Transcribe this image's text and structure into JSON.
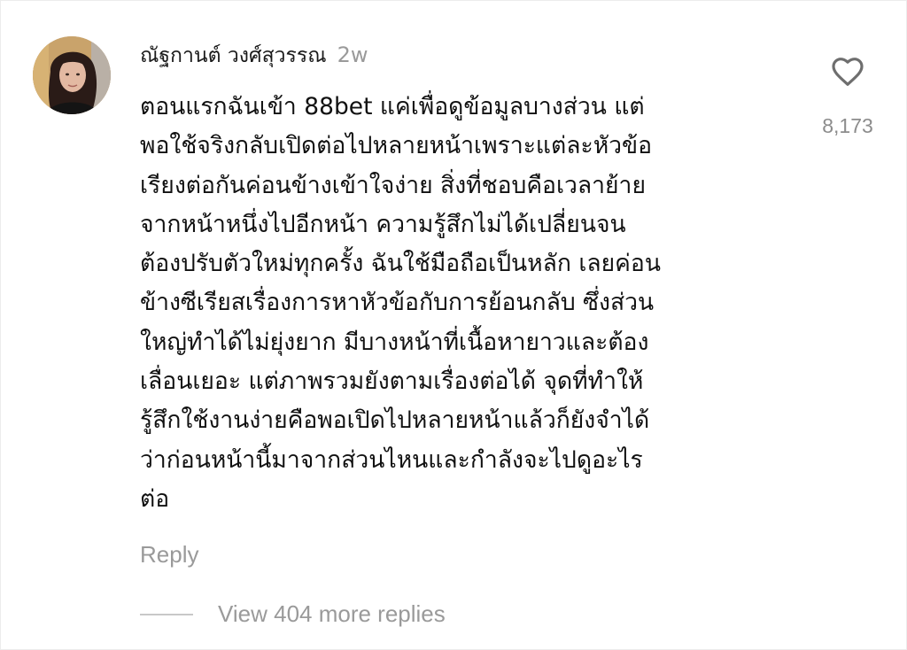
{
  "comment": {
    "author": "ณัฐกานต์ วงศ์สุวรรณ",
    "time": "2w",
    "lines": [
      "ตอนแรกฉันเข้า 88bet แค่เพื่อดูข้อมูลบางส่วน แต่",
      "พอใช้จริงกลับเปิดต่อไปหลายหน้าเพราะแต่ละหัวข้อ",
      "เรียงต่อกันค่อนข้างเข้าใจง่าย สิ่งที่ชอบคือเวลาย้าย",
      "จากหน้าหนึ่งไปอีกหน้า ความรู้สึกไม่ได้เปลี่ยนจน",
      "ต้องปรับตัวใหม่ทุกครั้ง ฉันใช้มือถือเป็นหลัก เลยค่อน",
      "ข้างซีเรียสเรื่องการหาหัวข้อกับการย้อนกลับ ซึ่งส่วน",
      "ใหญ่ทำได้ไม่ยุ่งยาก มีบางหน้าที่เนื้อหายาวและต้อง",
      "เลื่อนเยอะ แต่ภาพรวมยังตามเรื่องต่อได้ จุดที่ทำให้",
      "รู้สึกใช้งานง่ายคือพอเปิดไปหลายหน้าแล้วก็ยังจำได้",
      "ว่าก่อนหน้านี้มาจากส่วนไหนและกำลังจะไปดูอะไร",
      "ต่อ"
    ],
    "like_count": "8,173",
    "like_icon": "heart-outline-icon",
    "reply_label": "Reply",
    "view_replies_label": "View 404 more replies"
  },
  "colors": {
    "text_primary": "#111111",
    "text_secondary": "#9a9a9a",
    "background": "#ffffff"
  }
}
